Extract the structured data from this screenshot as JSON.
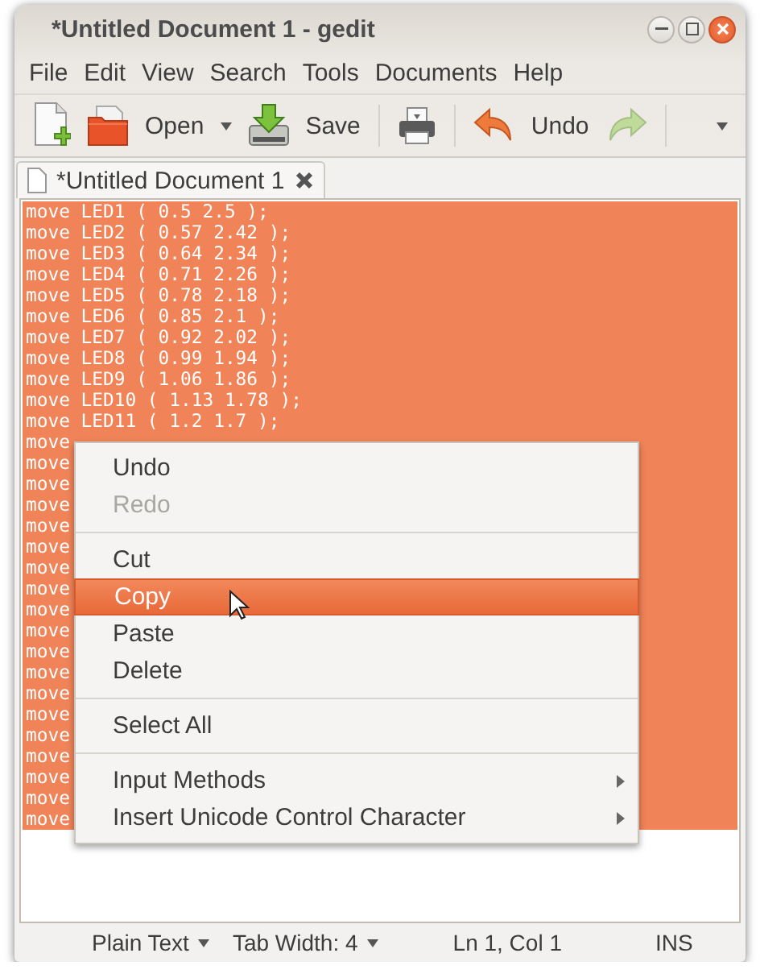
{
  "window": {
    "title": "*Untitled Document 1 - gedit"
  },
  "menubar": [
    "File",
    "Edit",
    "View",
    "Search",
    "Tools",
    "Documents",
    "Help"
  ],
  "toolbar": [
    {
      "kind": "new"
    },
    {
      "kind": "open",
      "label": "Open",
      "dropdown": true
    },
    {
      "kind": "save",
      "label": "Save"
    },
    {
      "kind": "separator"
    },
    {
      "kind": "print"
    },
    {
      "kind": "separator"
    },
    {
      "kind": "undo",
      "label": "Undo"
    },
    {
      "kind": "redo",
      "disabled": true
    },
    {
      "kind": "separator"
    },
    {
      "kind": "overflow"
    }
  ],
  "tabs": [
    {
      "label": "*Untitled Document 1",
      "selected": true
    }
  ],
  "editor": {
    "selected": true,
    "lines": [
      "move LED1 ( 0.5 2.5 );",
      "move LED2 ( 0.57 2.42 );",
      "move LED3 ( 0.64 2.34 );",
      "move LED4 ( 0.71 2.26 );",
      "move LED5 ( 0.78 2.18 );",
      "move LED6 ( 0.85 2.1 );",
      "move LED7 ( 0.92 2.02 );",
      "move LED8 ( 0.99 1.94 );",
      "move LED9 ( 1.06 1.86 );",
      "move LED10 ( 1.13 1.78 );",
      "move LED11 ( 1.2 1.7 );",
      "move",
      "move",
      "move",
      "move",
      "move",
      "move",
      "move",
      "move",
      "move",
      "move",
      "move",
      "move",
      "move",
      "move",
      "move",
      "move",
      "move",
      "move",
      "move"
    ]
  },
  "context_menu": [
    {
      "kind": "item",
      "label": "Undo",
      "disabled": false,
      "selected": false
    },
    {
      "kind": "item",
      "label": "Redo",
      "disabled": true,
      "selected": false
    },
    {
      "kind": "separator"
    },
    {
      "kind": "item",
      "label": "Cut",
      "disabled": false,
      "selected": false
    },
    {
      "kind": "item",
      "label": "Copy",
      "disabled": false,
      "selected": true
    },
    {
      "kind": "item",
      "label": "Paste",
      "disabled": false,
      "selected": false
    },
    {
      "kind": "item",
      "label": "Delete",
      "disabled": false,
      "selected": false
    },
    {
      "kind": "separator"
    },
    {
      "kind": "item",
      "label": "Select All",
      "disabled": false,
      "selected": false
    },
    {
      "kind": "separator"
    },
    {
      "kind": "submenu",
      "label": "Input Methods",
      "disabled": false,
      "selected": false
    },
    {
      "kind": "submenu",
      "label": "Insert Unicode Control Character",
      "disabled": false,
      "selected": false
    }
  ],
  "status_bar": [
    {
      "label": "Plain Text",
      "dropdown": true
    },
    {
      "label": "Tab Width:  4",
      "dropdown": true
    },
    {
      "label": "Ln 1, Col 1",
      "dropdown": false
    },
    {
      "label": "INS",
      "dropdown": false
    }
  ]
}
